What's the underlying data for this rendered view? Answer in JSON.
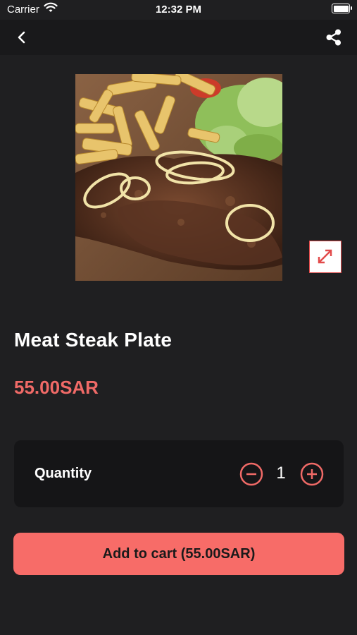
{
  "status_bar": {
    "carrier": "Carrier",
    "time": "12:32 PM"
  },
  "nav": {
    "back_icon": "chevron-left-icon",
    "share_icon": "share-icon"
  },
  "product": {
    "image_icon": "steak-plate-photo",
    "expand_icon": "expand-icon",
    "name": "Meat Steak Plate",
    "price": "55.00SAR"
  },
  "quantity": {
    "label": "Quantity",
    "value": "1",
    "decrement_icon": "minus-circle-icon",
    "increment_icon": "plus-circle-icon"
  },
  "cart": {
    "add_label": "Add to cart (55.00SAR)"
  },
  "colors": {
    "background": "#1f1f21",
    "accent": "#f76c68",
    "price": "#f06a67",
    "card": "#151517"
  }
}
